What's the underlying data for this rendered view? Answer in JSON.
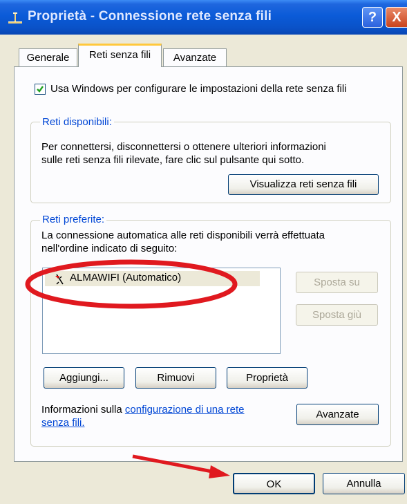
{
  "window": {
    "title": "Proprietà - Connessione rete senza fili",
    "help_label": "?",
    "close_label": "X"
  },
  "tabs": [
    {
      "label": "Generale",
      "active": false
    },
    {
      "label": "Reti senza fili",
      "active": true
    },
    {
      "label": "Avanzate",
      "active": false
    }
  ],
  "use_windows_checkbox": {
    "label": "Usa Windows per configurare le impostazioni della rete senza fili",
    "checked": true
  },
  "available_networks": {
    "legend": "Reti disponibili:",
    "line1": "Per connettersi, disconnettersi o ottenere ulteriori informazioni",
    "line2": "sulle reti senza fili rilevate, fare clic sul pulsante qui sotto.",
    "view_button": "Visualizza reti senza fili"
  },
  "preferred_networks": {
    "legend": "Reti preferite:",
    "line1": "La connessione automatica alle reti disponibili verrà effettuata",
    "line2": "nell'ordine indicato di seguito:",
    "items": [
      {
        "label": "ALMAWIFI (Automatico)",
        "icon": "wireless-network-icon"
      }
    ],
    "move_up": "Sposta su",
    "move_down": "Sposta giù",
    "add": "Aggiungi...",
    "remove": "Rimuovi",
    "properties": "Proprietà"
  },
  "info": {
    "prefix": "Informazioni sulla ",
    "link_line1": "configurazione di una rete",
    "link_line2": "senza fili.",
    "advanced_button": "Avanzate"
  },
  "footer": {
    "ok": "OK",
    "cancel": "Annulla"
  },
  "colors": {
    "titlebar": "#0a52c8",
    "legend_text": "#0046d5",
    "annotation": "#e0191f",
    "tab_highlight": "#ffc83c"
  }
}
